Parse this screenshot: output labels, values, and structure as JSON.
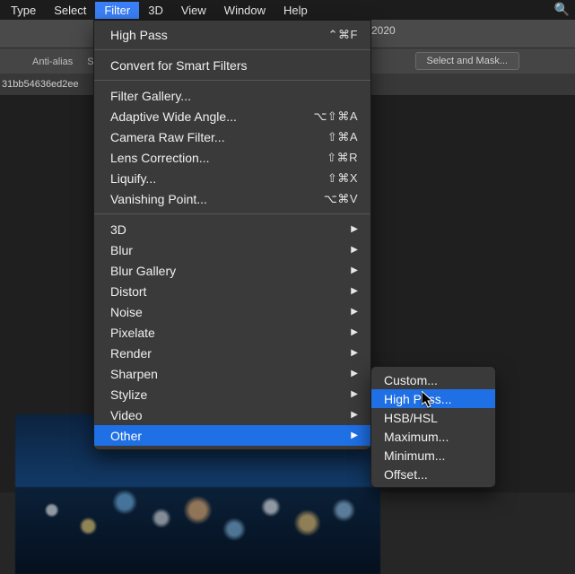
{
  "menubar": {
    "items": [
      "Type",
      "Select",
      "Filter",
      "3D",
      "View",
      "Window",
      "Help"
    ],
    "active": "Filter"
  },
  "toolbar": {
    "doc_title": "2020",
    "anti_alias": "Anti-alias",
    "style": "Style:",
    "select_mask": "Select and Mask..."
  },
  "tab": {
    "label": "31bb54636ed2ee"
  },
  "filter_menu": {
    "last": {
      "label": "High Pass",
      "shortcut": "⌃⌘F"
    },
    "convert": {
      "label": "Convert for Smart Filters"
    },
    "group1": [
      {
        "label": "Filter Gallery...",
        "shortcut": ""
      },
      {
        "label": "Adaptive Wide Angle...",
        "shortcut": "⌥⇧⌘A"
      },
      {
        "label": "Camera Raw Filter...",
        "shortcut": "⇧⌘A"
      },
      {
        "label": "Lens Correction...",
        "shortcut": "⇧⌘R"
      },
      {
        "label": "Liquify...",
        "shortcut": "⇧⌘X"
      },
      {
        "label": "Vanishing Point...",
        "shortcut": "⌥⌘V"
      }
    ],
    "group2": [
      {
        "label": "3D"
      },
      {
        "label": "Blur"
      },
      {
        "label": "Blur Gallery"
      },
      {
        "label": "Distort"
      },
      {
        "label": "Noise"
      },
      {
        "label": "Pixelate"
      },
      {
        "label": "Render"
      },
      {
        "label": "Sharpen"
      },
      {
        "label": "Stylize"
      },
      {
        "label": "Video"
      },
      {
        "label": "Other"
      }
    ]
  },
  "submenu_other": {
    "items": [
      {
        "label": "Custom..."
      },
      {
        "label": "High Pass..."
      },
      {
        "label": "HSB/HSL"
      },
      {
        "label": "Maximum..."
      },
      {
        "label": "Minimum..."
      },
      {
        "label": "Offset..."
      }
    ],
    "highlight_index": 1
  }
}
